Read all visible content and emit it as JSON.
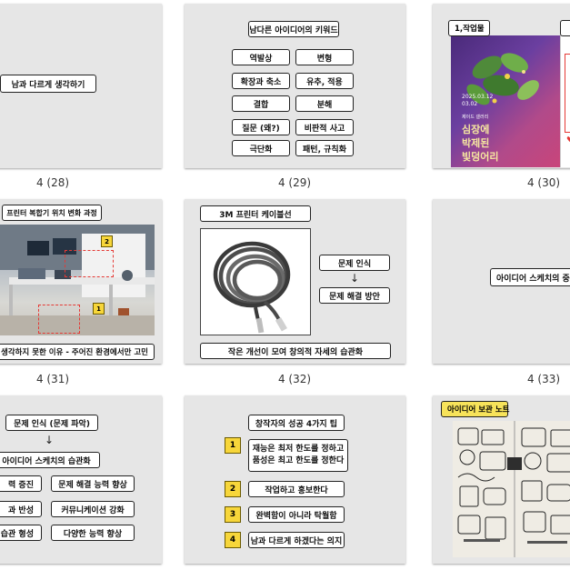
{
  "captions": [
    "4 (28)",
    "4 (29)",
    "4 (30)",
    "4 (31)",
    "4 (32)",
    "4 (33)"
  ],
  "slide_28": {
    "box": "남과 다르게 생각하기"
  },
  "slide_29": {
    "title": "남다른 아이디어의 키워드",
    "left": [
      "역발상",
      "확장과 축소",
      "결합",
      "질문 (왜?)",
      "극단화"
    ],
    "right": [
      "변형",
      "유추, 적용",
      "분해",
      "비판적 사고",
      "패턴, 규칙화"
    ]
  },
  "slide_30": {
    "tag": "1,작업물",
    "poster_lines": [
      "2025.03.12",
      "03.02",
      "제이드 갤러리",
      "심장에",
      "박제된",
      "빛덩어리"
    ]
  },
  "slide_31": {
    "title": "프린터 복합기 위치 변화 과정",
    "marker1": "1",
    "marker2": "2",
    "bottom": "을 생각하지 못한 이유 - 주어진 환경에서만 고민"
  },
  "slide_32": {
    "title": "3M 프린터 케이블선",
    "box1": "문제 인식",
    "arrow": "↓",
    "box2": "문제 해결 방안",
    "bottom": "작은 개선이 모여 창의적 자세의 습관화"
  },
  "slide_33": {
    "box": "아이디어 스케치의 중"
  },
  "slide_34": {
    "box1": "문제 인식 (문제 파악)",
    "arrow": "↓",
    "box2": "아이디어 스케치의 습관화",
    "left": [
      "력 증진",
      "과 반성",
      "은 습관 형성"
    ],
    "right": [
      "문제 해결 능력 향상",
      "커뮤니케이션 강화",
      "다양한 능력 향상"
    ]
  },
  "slide_35": {
    "title": "창작자의 성공  4가지 팁",
    "tips": [
      {
        "n": "1",
        "line1": "재능은 최저 한도를 정하고",
        "line2": "품성은 최고 한도를 정한다"
      },
      {
        "n": "2",
        "line1": "작업하고 홍보한다",
        "line2": ""
      },
      {
        "n": "3",
        "line1": "완벽함이 아니라 탁월함",
        "line2": ""
      },
      {
        "n": "4",
        "line1": "남과 다르게 하겠다는 의지",
        "line2": ""
      }
    ]
  },
  "slide_36": {
    "tag": "아이디어 보관 노트"
  },
  "colors": {
    "slide_bg": "#e6e6e6",
    "number_badge": "#f7d63a",
    "marker": "#e53935",
    "note_tag": "#f7e35a"
  }
}
